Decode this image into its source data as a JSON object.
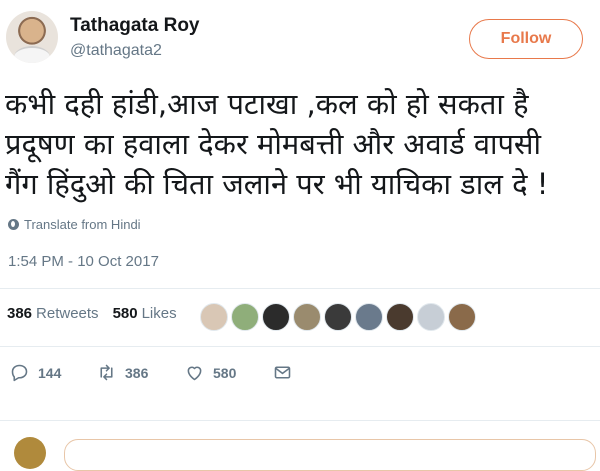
{
  "author": {
    "name": "Tathagata Roy",
    "handle": "@tathagata2"
  },
  "follow_label": "Follow",
  "tweet": {
    "lines": [
      "कभी दही हांडी,आज पटाखा ,कल को हो सकता है",
      "प्रदूषण का हवाला देकर मोमबत्ती और अवार्ड वापसी",
      "गैंग हिंदुओ की चिता जलाने पर भी याचिका डाल दे !"
    ]
  },
  "translate_label": "Translate from Hindi",
  "timestamp": "1:54 PM - 10 Oct 2017",
  "stats": {
    "retweets": "386",
    "retweets_label": "Retweets",
    "likes": "580",
    "likes_label": "Likes"
  },
  "likers": [
    {
      "icon": "liker-avatar-1",
      "color": "#d9c7b5"
    },
    {
      "icon": "liker-avatar-2",
      "color": "#8fae7a"
    },
    {
      "icon": "liker-avatar-3",
      "color": "#2b2b2b"
    },
    {
      "icon": "liker-avatar-4",
      "color": "#9a8b6e"
    },
    {
      "icon": "liker-avatar-5",
      "color": "#3a3a3a"
    },
    {
      "icon": "liker-avatar-6",
      "color": "#6a7a8c"
    },
    {
      "icon": "liker-avatar-7",
      "color": "#4a3a2e"
    },
    {
      "icon": "liker-avatar-8",
      "color": "#c7ced6"
    },
    {
      "icon": "liker-avatar-9",
      "color": "#8a6a4a"
    }
  ],
  "actions": {
    "replies": "144",
    "retweets": "386",
    "likes": "580"
  },
  "colors": {
    "accent": "#e8794b",
    "secondary_text": "#657786",
    "divider": "#e6ecf0"
  }
}
